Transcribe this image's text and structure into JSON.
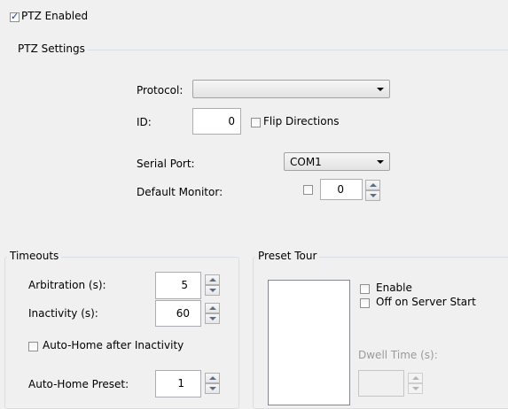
{
  "ptz_enabled": {
    "label": "PTZ Enabled",
    "checked": true
  },
  "ptz_settings": {
    "title": "PTZ Settings",
    "protocol_label": "Protocol:",
    "protocol_value": "",
    "id_label": "ID:",
    "id_value": "0",
    "flip_label": "Flip Directions",
    "flip_checked": false,
    "serial_port_label": "Serial Port:",
    "serial_port_value": "COM1",
    "default_monitor_label": "Default Monitor:",
    "default_monitor_checked": false,
    "default_monitor_value": "0"
  },
  "timeouts": {
    "title": "Timeouts",
    "arbitration_label": "Arbitration (s):",
    "arbitration_value": "5",
    "inactivity_label": "Inactivity (s):",
    "inactivity_value": "60",
    "autohome_label": "Auto-Home after Inactivity",
    "autohome_checked": false,
    "autohome_preset_label": "Auto-Home Preset:",
    "autohome_preset_value": "1"
  },
  "preset_tour": {
    "title": "Preset Tour",
    "enable_label": "Enable",
    "enable_checked": false,
    "off_on_start_label": "Off on Server Start",
    "off_on_start_checked": false,
    "dwell_label": "Dwell Time (s):",
    "dwell_value": ""
  }
}
